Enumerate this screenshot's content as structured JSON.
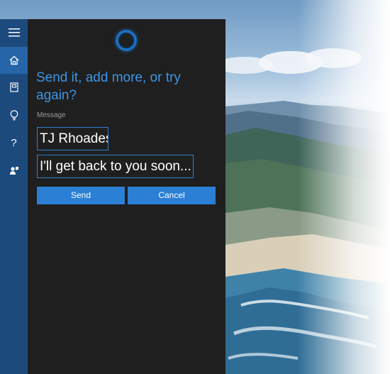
{
  "cortana": {
    "prompt": "Send it, add more, or try again?",
    "message_label": "Message",
    "recipient": "TJ Rhoades",
    "message_text": "I'll get back to you soon...",
    "send_label": "Send",
    "cancel_label": "Cancel"
  },
  "rail": {
    "items": [
      {
        "icon": "hamburger-menu-icon"
      },
      {
        "icon": "home-icon",
        "active": true
      },
      {
        "icon": "notebook-icon"
      },
      {
        "icon": "lightbulb-icon"
      },
      {
        "icon": "help-icon",
        "glyph": "?"
      },
      {
        "icon": "feedback-icon"
      }
    ]
  },
  "colors": {
    "accent": "#2b7fd4",
    "prompt_text": "#3d95e6",
    "panel_bg": "#1f1f1f",
    "rail_bg": "#1d4a7d",
    "rail_active": "#2565a8"
  }
}
